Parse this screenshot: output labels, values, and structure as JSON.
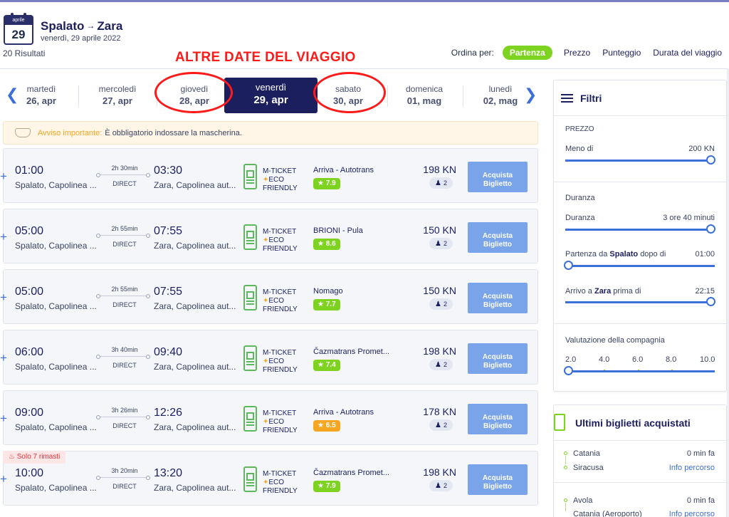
{
  "header": {
    "calendar_month": "aprile",
    "calendar_day": "29",
    "route_from": "Spalato",
    "route_arrow": "→",
    "route_to": "Zara",
    "date_line": "venerdì, 29 aprile 2022",
    "results": "20 Risultati",
    "annotation": "ALTRE DATE DEL VIAGGIO"
  },
  "sort": {
    "label": "Ordina per:",
    "active": "Partenza",
    "options": [
      "Prezzo",
      "Punteggio",
      "Durata del viaggio"
    ]
  },
  "dates": [
    {
      "weekday": "martedì",
      "date": "26, apr"
    },
    {
      "weekday": "mercoledì",
      "date": "27, apr"
    },
    {
      "weekday": "giovedì",
      "date": "28, apr"
    },
    {
      "weekday": "venerdì",
      "date": "29, apr"
    },
    {
      "weekday": "sabato",
      "date": "30, apr"
    },
    {
      "weekday": "domenica",
      "date": "01, mag"
    },
    {
      "weekday": "lunedì",
      "date": "02, mag"
    }
  ],
  "notice": {
    "label": "Avviso importante:",
    "text": "È obbligatorio indossare la mascherina."
  },
  "ticket_type": {
    "line1": "M-TICKET",
    "line2": "ECO",
    "line3": "FRIENDLY"
  },
  "buy_label": {
    "line1": "Acquista",
    "line2": "Biglietto"
  },
  "trips": [
    {
      "dep": "01:00",
      "from": "Spalato, Capolinea ...",
      "duration": "2h 30min",
      "type": "DIRECT",
      "arr": "03:30",
      "to": "Zara, Capolinea aut...",
      "operator": "Arriva - Autotrans",
      "rating": "7.9",
      "rating_color": "#7ed321",
      "price": "198 KN",
      "seats": "2"
    },
    {
      "dep": "05:00",
      "from": "Spalato, Capolinea ...",
      "duration": "2h 55min",
      "type": "DIRECT",
      "arr": "07:55",
      "to": "Zara, Capolinea aut...",
      "operator": "BRIONI - Pula",
      "rating": "8.6",
      "rating_color": "#7ed321",
      "price": "150 KN",
      "seats": "2"
    },
    {
      "dep": "05:00",
      "from": "Spalato, Capolinea ...",
      "duration": "2h 55min",
      "type": "DIRECT",
      "arr": "07:55",
      "to": "Zara, Capolinea aut...",
      "operator": "Nomago",
      "rating": "7.7",
      "rating_color": "#7ed321",
      "price": "150 KN",
      "seats": "2"
    },
    {
      "dep": "06:00",
      "from": "Spalato, Capolinea ...",
      "duration": "3h 40min",
      "type": "DIRECT",
      "arr": "09:40",
      "to": "Zara, Capolinea aut...",
      "operator": "Čazmatrans Promet...",
      "rating": "7.4",
      "rating_color": "#7ed321",
      "price": "198 KN",
      "seats": "2"
    },
    {
      "dep": "09:00",
      "from": "Spalato, Capolinea ...",
      "duration": "3h 26min",
      "type": "DIRECT",
      "arr": "12:26",
      "to": "Zara, Capolinea aut...",
      "operator": "Arriva - Autotrans",
      "rating": "6.5",
      "rating_color": "#f5a623",
      "price": "178 KN",
      "seats": "2"
    },
    {
      "dep": "10:00",
      "from": "Spalato, Capolinea ...",
      "duration": "3h 20min",
      "type": "DIRECT",
      "arr": "13:20",
      "to": "Zara, Capolinea aut...",
      "operator": "Čazmatrans Promet...",
      "rating": "7.9",
      "rating_color": "#7ed321",
      "price": "198 KN",
      "seats": "2"
    }
  ],
  "remaining_badge": "Solo 7 rimasti",
  "filters": {
    "title": "Filtri",
    "price_section": "PREZZO",
    "price_label": "Meno di",
    "price_value": "200 KN",
    "duration_section": "Duranza",
    "duration_label": "Duranza",
    "duration_value": "3 ore 40 minuti",
    "departure_prefix": "Partenza da",
    "departure_city": "Spalato",
    "departure_suffix": "dopo di",
    "departure_value": "01:00",
    "arrival_prefix": "Arrivo a",
    "arrival_city": "Zara",
    "arrival_suffix": "prima di",
    "arrival_value": "22:15",
    "rating_section": "Valutazione della compagnia",
    "rating_ticks": [
      "2.0",
      "4.0",
      "6.0",
      "8.0",
      "10.0"
    ]
  },
  "last_tickets": {
    "title": "Ultimi biglietti acquistati",
    "items": [
      {
        "from": "Catania",
        "to": "Siracusa",
        "time": "0 min fa",
        "link": "Info percorso"
      },
      {
        "from": "Avola",
        "to": "Catania (Aeroporto)",
        "time": "0 min fa",
        "link": "Info percorso"
      }
    ]
  }
}
